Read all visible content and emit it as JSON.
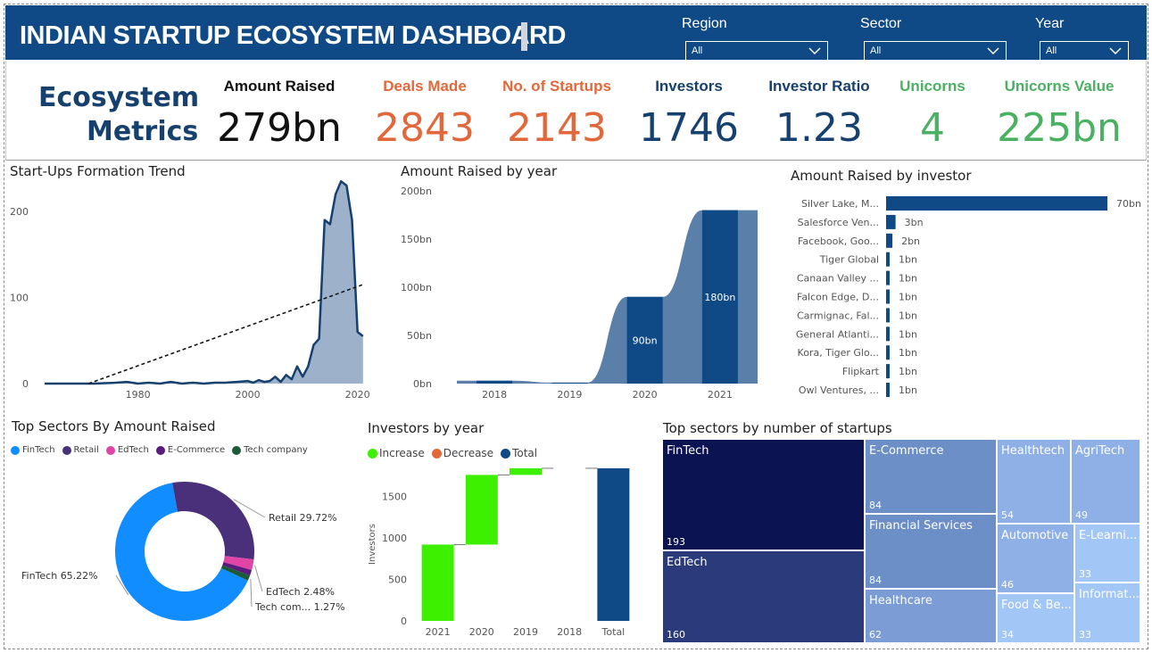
{
  "header": {
    "title": "INDIAN STARTUP ECOSYSTEM DASHBOARD",
    "slicers": [
      {
        "label": "Region",
        "value": "All"
      },
      {
        "label": "Sector",
        "value": "All"
      },
      {
        "label": "Year",
        "value": "All"
      }
    ]
  },
  "metrics": {
    "heading_line1": "Ecosystem",
    "heading_line2": "Metrics",
    "kpis": [
      {
        "label": "Amount Raised",
        "value": "279bn",
        "color": "#111111"
      },
      {
        "label": "Deals Made",
        "value": "2843",
        "color": "#e2683c"
      },
      {
        "label": "No. of Startups",
        "value": "2143",
        "color": "#e2683c"
      },
      {
        "label": "Investors",
        "value": "1746",
        "color": "#16416f"
      },
      {
        "label": "Investor Ratio",
        "value": "1.23",
        "color": "#16416f"
      },
      {
        "label": "Unicorns",
        "value": "4",
        "color": "#4bb162"
      },
      {
        "label": "Unicorns Value",
        "value": "225bn",
        "color": "#4bb162"
      }
    ]
  },
  "chart_data": [
    {
      "id": "formation",
      "type": "area",
      "title": "Start-Ups Formation Trend",
      "xlim": [
        1963,
        2022
      ],
      "ylim": [
        0,
        230
      ],
      "xticks": [
        "1980",
        "2000",
        "2020"
      ],
      "yticks": [
        "0",
        "100",
        "200"
      ],
      "x": [
        1963,
        1968,
        1972,
        1976,
        1978,
        1980,
        1982,
        1984,
        1986,
        1988,
        1990,
        1992,
        1994,
        1996,
        1998,
        2000,
        2001,
        2002,
        2003,
        2004,
        2005,
        2006,
        2007,
        2008,
        2009,
        2010,
        2011,
        2012,
        2013,
        2014,
        2015,
        2016,
        2017,
        2018,
        2019,
        2020,
        2021
      ],
      "values": [
        0,
        0,
        0,
        1,
        2,
        0,
        1,
        0,
        2,
        0,
        1,
        0,
        1,
        1,
        2,
        3,
        1,
        4,
        2,
        3,
        8,
        2,
        10,
        5,
        20,
        8,
        20,
        45,
        52,
        190,
        185,
        220,
        235,
        230,
        190,
        60,
        55
      ],
      "trend": {
        "from": [
          1971,
          0
        ],
        "to": [
          2021,
          115
        ]
      },
      "colors": {
        "line": "#16416f",
        "fill": "#9db1ca",
        "trend": "#111111"
      }
    },
    {
      "id": "amount-year",
      "type": "area",
      "title": "Amount Raised by year",
      "categories": [
        "2018",
        "2019",
        "2020",
        "2021"
      ],
      "values": [
        3,
        1,
        90,
        180
      ],
      "ylim": [
        0,
        200
      ],
      "yticks": [
        "0bn",
        "50bn",
        "100bn",
        "150bn",
        "200bn"
      ],
      "labels": [
        "",
        "",
        "90bn",
        "180bn"
      ],
      "colors": {
        "area": "#5a7fa9",
        "bar": "#0f4a86",
        "label": "#ffffff"
      }
    },
    {
      "id": "investor-bars",
      "type": "bar",
      "title": "Amount Raised by investor",
      "categories": [
        "Silver Lake, M...",
        "Salesforce Ven...",
        "Facebook, Goo...",
        "Tiger Global",
        "Canaan Valley ...",
        "Falcon Edge, D...",
        "Carmignac, Fal...",
        "General Atlanti...",
        "Kora, Tiger Glo...",
        "Flipkart",
        "Owl Ventures, ..."
      ],
      "values": [
        70,
        3,
        2,
        1,
        1,
        1,
        1,
        1,
        1,
        1,
        1
      ],
      "value_labels": [
        "70bn",
        "3bn",
        "2bn",
        "1bn",
        "1bn",
        "1bn",
        "1bn",
        "1bn",
        "1bn",
        "1bn",
        "1bn"
      ],
      "xlim": [
        0,
        70
      ],
      "colors": {
        "bar": "#0f4a86"
      }
    },
    {
      "id": "sector-donut",
      "type": "pie",
      "title": "Top Sectors By Amount Raised",
      "series": [
        {
          "name": "FinTech",
          "value": 65.22,
          "label": "FinTech 65.22%",
          "color": "#118dff"
        },
        {
          "name": "Retail",
          "value": 29.72,
          "label": "Retail 29.72%",
          "color": "#4a2f7a"
        },
        {
          "name": "EdTech",
          "value": 2.48,
          "label": "EdTech 2.48%",
          "color": "#e044a7"
        },
        {
          "name": "E-Commerce",
          "value": 1.31,
          "label": "",
          "color": "#5a1a7e"
        },
        {
          "name": "Tech company",
          "value": 1.27,
          "label": "Tech com... 1.27%",
          "color": "#1d5a3a"
        }
      ]
    },
    {
      "id": "investors-waterfall",
      "type": "bar",
      "title": "Investors by year",
      "ylabel": "Investors",
      "ylim": [
        0,
        1850
      ],
      "yticks": [
        "0",
        "500",
        "1000",
        "1500"
      ],
      "legend": [
        {
          "name": "Increase",
          "color": "#3df000"
        },
        {
          "name": "Decrease",
          "color": "#e2683c"
        },
        {
          "name": "Total",
          "color": "#0f4a86"
        }
      ],
      "categories": [
        "2021",
        "2020",
        "2019",
        "2018",
        "Total"
      ],
      "steps": [
        {
          "category": "2021",
          "start": 0,
          "end": 920,
          "kind": "Increase"
        },
        {
          "category": "2020",
          "start": 920,
          "end": 1760,
          "kind": "Increase"
        },
        {
          "category": "2019",
          "start": 1760,
          "end": 1840,
          "kind": "Increase"
        },
        {
          "category": "2018",
          "start": 1840,
          "end": 1840,
          "kind": "Increase"
        },
        {
          "category": "Total",
          "start": 0,
          "end": 1840,
          "kind": "Total"
        }
      ]
    },
    {
      "id": "sector-treemap",
      "type": "table",
      "title": "Top sectors by number of startups",
      "items": [
        {
          "name": "FinTech",
          "value": "193",
          "color": "#0c1352"
        },
        {
          "name": "EdTech",
          "value": "160",
          "color": "#2b3a7a"
        },
        {
          "name": "E-Commerce",
          "value": "84",
          "color": "#6c8fc8"
        },
        {
          "name": "Financial Services",
          "value": "84",
          "color": "#6c8fc8"
        },
        {
          "name": "Healthcare",
          "value": "62",
          "color": "#7b9cd4"
        },
        {
          "name": "Healthtech",
          "value": "54",
          "color": "#8fb0e6"
        },
        {
          "name": "AgriTech",
          "value": "49",
          "color": "#8fb0e6"
        },
        {
          "name": "Automotive",
          "value": "46",
          "color": "#8fb0e6"
        },
        {
          "name": "E-Learni...",
          "value": "33",
          "color": "#a2c6f5"
        },
        {
          "name": "Food & Be...",
          "value": "34",
          "color": "#a2c6f5"
        },
        {
          "name": "Informat...",
          "value": "33",
          "color": "#a2c6f5"
        }
      ]
    }
  ]
}
